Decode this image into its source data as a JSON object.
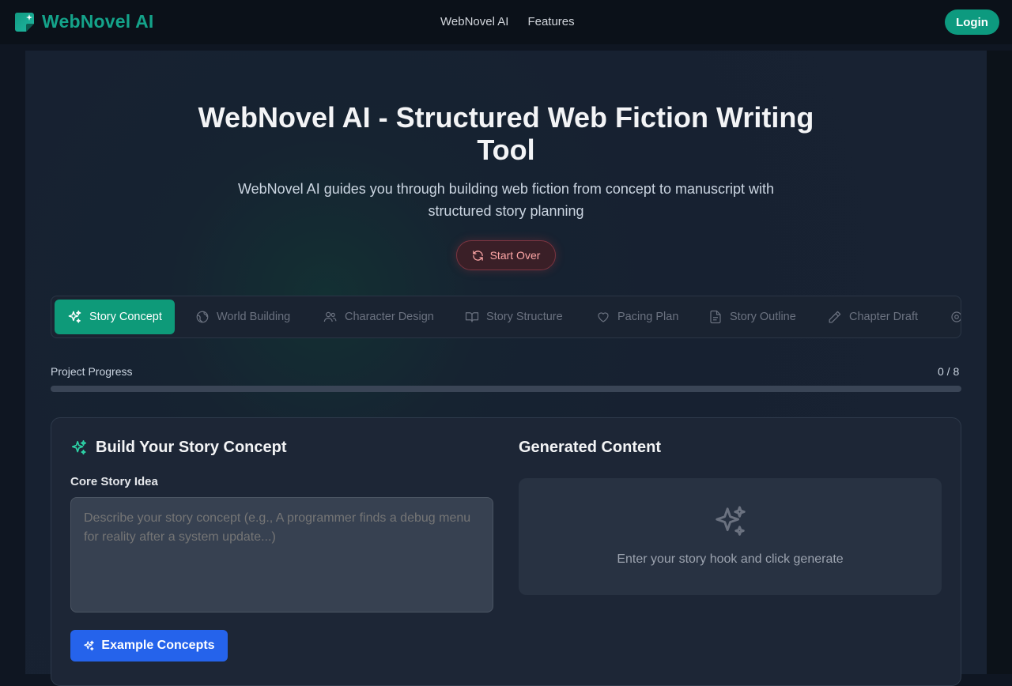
{
  "header": {
    "brand": "WebNovel AI",
    "nav": [
      "WebNovel AI",
      "Features"
    ],
    "login_label": "Login",
    "accent": "#14a38a"
  },
  "hero": {
    "title_line1": "WebNovel AI - Structured Web Fiction Writing",
    "title_line2": "Tool",
    "subtitle_line1": "WebNovel AI guides you through building web fiction from concept to manuscript with",
    "subtitle_line2": "structured story planning",
    "start_over_label": "Start Over"
  },
  "tabs": [
    {
      "label": "Story Concept",
      "icon": "sparkles-icon",
      "active": true
    },
    {
      "label": "World Building",
      "icon": "globe-icon",
      "active": false
    },
    {
      "label": "Character Design",
      "icon": "users-icon",
      "active": false
    },
    {
      "label": "Story Structure",
      "icon": "book-icon",
      "active": false
    },
    {
      "label": "Pacing Plan",
      "icon": "heart-icon",
      "active": false
    },
    {
      "label": "Story Outline",
      "icon": "file-icon",
      "active": false
    },
    {
      "label": "Chapter Draft",
      "icon": "pencil-icon",
      "active": false
    }
  ],
  "progress": {
    "label": "Project Progress",
    "count_text": "0 / 8",
    "fraction": 0
  },
  "concept": {
    "title": "Build Your Story Concept",
    "field_label": "Core Story Idea",
    "placeholder": "Describe your story concept (e.g., A programmer finds a debug menu for reality after a system update...)",
    "value": "",
    "example_label": "Example Concepts"
  },
  "generated": {
    "title": "Generated Content",
    "empty_text": "Enter your story hook and click generate"
  },
  "colors": {
    "primary": "#0e9a79",
    "blue": "#2563eb",
    "danger": "#fca5a5"
  }
}
